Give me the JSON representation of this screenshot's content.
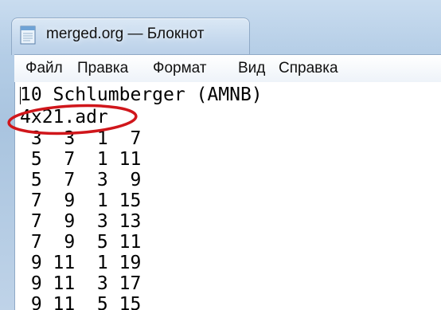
{
  "window": {
    "title": "merged.org — Блокнот",
    "icon": "notepad-icon"
  },
  "menu": {
    "items": [
      {
        "label": "Файл"
      },
      {
        "label": "Правка"
      },
      {
        "label": "Формат"
      },
      {
        "label": "Вид"
      },
      {
        "label": "Справка"
      }
    ]
  },
  "editor": {
    "lines": [
      "10 Schlumberger (AMNB)",
      "4x21.adr",
      " 3  3  1  7",
      " 5  7  1 11",
      " 5  7  3  9",
      " 7  9  1 15",
      " 7  9  3 13",
      " 7  9  5 11",
      " 9 11  1 19",
      " 9 11  3 17",
      " 9 11  5 15"
    ]
  },
  "annotation": {
    "highlight_color": "#d0161b",
    "highlighted_text": "4x21.adr"
  }
}
